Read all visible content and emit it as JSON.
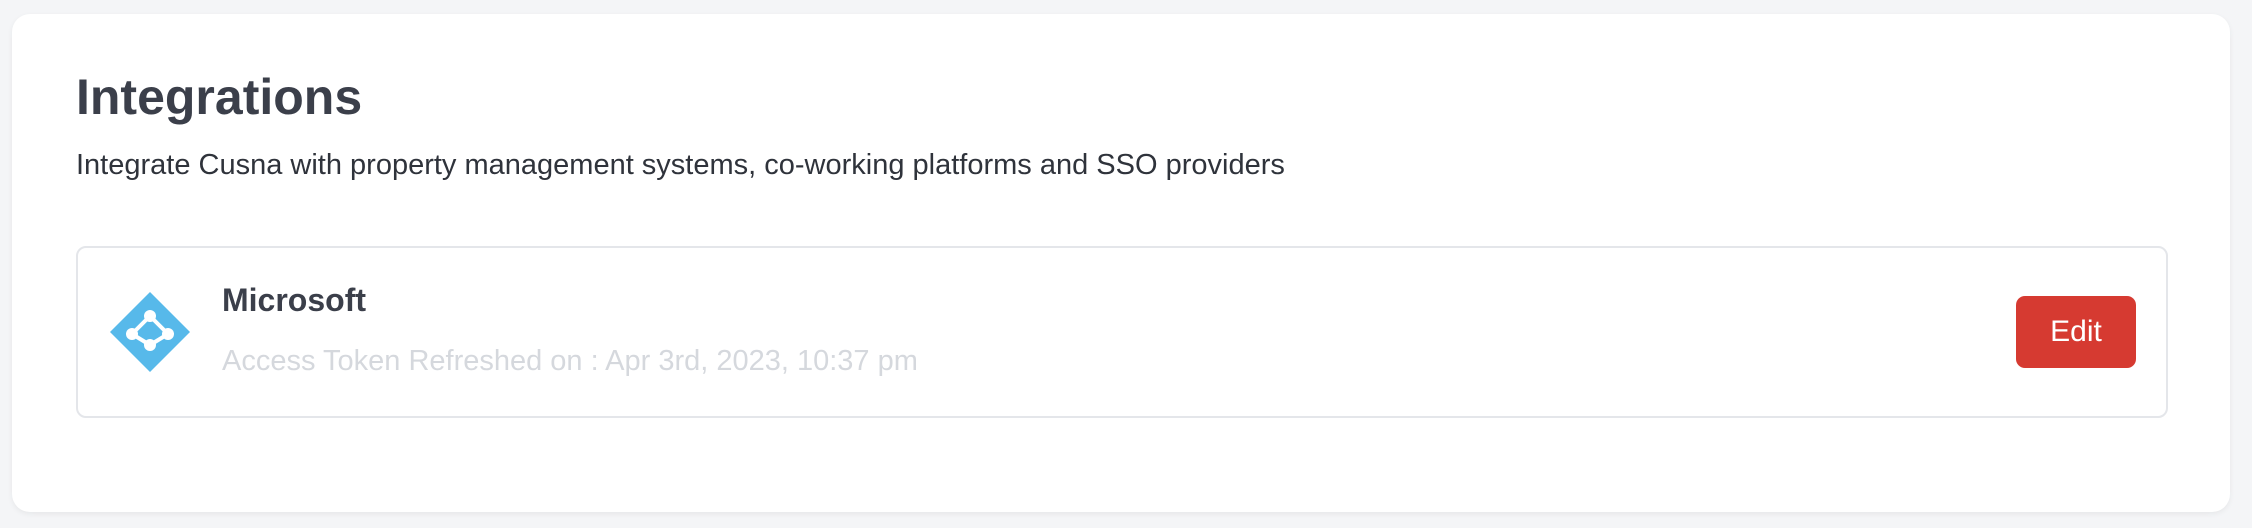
{
  "page": {
    "title": "Integrations",
    "subtitle": "Integrate Cusna with property management systems, co-working platforms and SSO providers"
  },
  "integrations": [
    {
      "name": "Microsoft",
      "status": "Access Token Refreshed on : Apr 3rd, 2023, 10:37 pm",
      "icon": "azure-ad-icon",
      "action_label": "Edit"
    }
  ],
  "colors": {
    "page_background": "#f4f5f7",
    "card_background": "#ffffff",
    "title": "#3b3f4a",
    "subtitle": "#2f333b",
    "status_text": "#d5d8dd",
    "edit_button": "#d63a31",
    "icon_blue": "#57b9ea"
  }
}
